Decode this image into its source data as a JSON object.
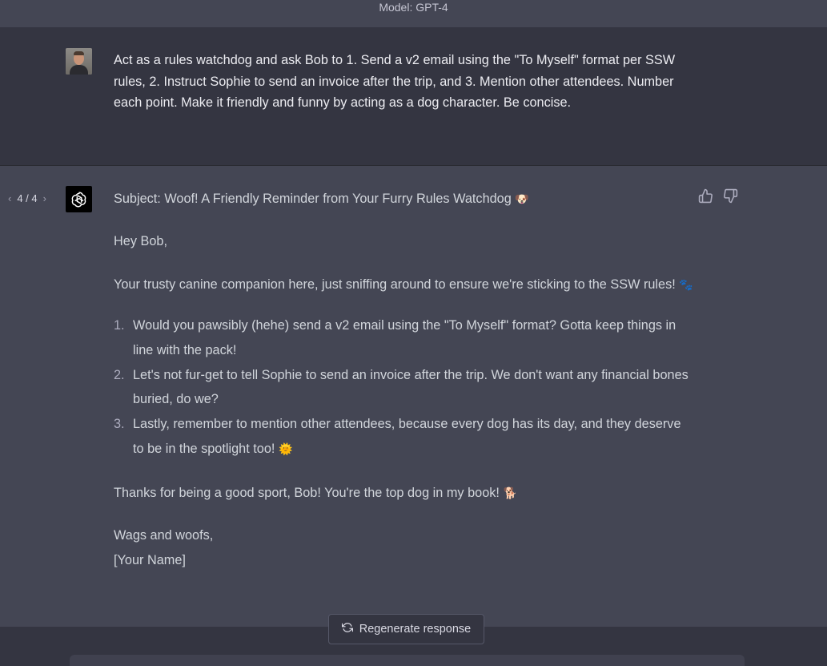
{
  "header": {
    "model_label": "Model: GPT-4"
  },
  "user_message": {
    "text": "Act as a rules watchdog and ask Bob to 1.  Send a v2 email using the \"To Myself\" format per SSW rules, 2. Instruct Sophie to send an invoice after the trip, and 3. Mention other attendees. Number each point. Make it friendly and funny by acting as a dog character. Be concise."
  },
  "assistant_message": {
    "pager": {
      "label": "4 / 4",
      "prev_icon": "chevron-left-icon",
      "next_icon": "chevron-right-icon"
    },
    "subject": "Subject: Woof! A Friendly Reminder from Your Furry Rules Watchdog",
    "subject_emoji": "🐶",
    "greeting": "Hey Bob,",
    "intro": "Your trusty canine companion here, just sniffing around to ensure we're sticking to the SSW rules!",
    "intro_emoji": "🐾",
    "points": [
      {
        "num": "1.",
        "text": "Would you pawsibly (hehe) send a v2 email using the \"To Myself\" format? Gotta keep things in line with the pack!",
        "emoji": ""
      },
      {
        "num": "2.",
        "text": "Let's not fur-get to tell Sophie to send an invoice after the trip. We don't want any financial bones buried, do we?",
        "emoji": ""
      },
      {
        "num": "3.",
        "text": "Lastly, remember to mention other attendees, because every dog has its day, and they deserve to be in the spotlight too!",
        "emoji": "🌞"
      }
    ],
    "closing": "Thanks for being a good sport, Bob! You're the top dog in my book!",
    "closing_emoji": "🐕",
    "signoff": "Wags and woofs,",
    "signature": "[Your Name]"
  },
  "actions": {
    "regenerate_label": "Regenerate response",
    "thumbs_up_icon": "thumbs-up-icon",
    "thumbs_down_icon": "thumbs-down-icon"
  },
  "colors": {
    "user_bg": "#343541",
    "assistant_bg": "#444654",
    "text": "#d1d5db"
  }
}
